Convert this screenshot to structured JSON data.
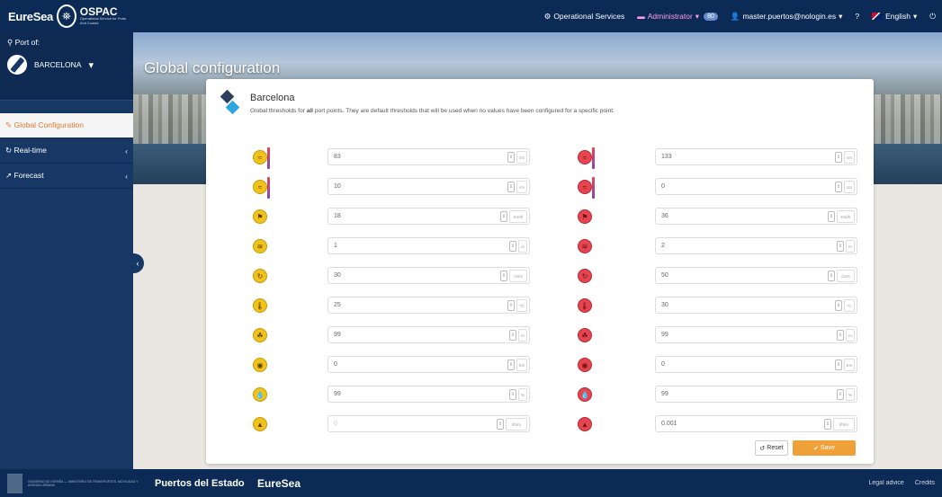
{
  "topbar": {
    "brand": "EureSea",
    "product": "OSPAC",
    "product_sub": "Operational Service for Ports And Coasts",
    "operational_services": "Operational Services",
    "administrator": "Administrator",
    "admin_badge": "80",
    "user": "master.puertos@nologin.es",
    "help": "?",
    "language": "English",
    "power_icon": "power-icon"
  },
  "sidebar": {
    "port_label": "Port of:",
    "port_name": "BARCELONA",
    "items": [
      {
        "label": "Global Configuration",
        "icon": "wrench-icon",
        "active": true
      },
      {
        "label": "Real-time",
        "icon": "refresh-icon"
      },
      {
        "label": "Forecast",
        "icon": "chart-icon"
      }
    ]
  },
  "page": {
    "title": "Global configuration"
  },
  "card": {
    "title": "Barcelona",
    "desc_before": "Global thresholds for ",
    "desc_bold": "all",
    "desc_after": " port points. They are default thresholds that will be used when no values have been configured for a specific point."
  },
  "thresholds": [
    {
      "icon": "wave-height-icon",
      "warn": "83",
      "warn_unit": "cm",
      "alert": "133",
      "alert_unit": "cm"
    },
    {
      "icon": "sea-level-icon",
      "warn": "10",
      "warn_unit": "cm",
      "alert": "0",
      "alert_unit": "cm"
    },
    {
      "icon": "wind-speed-icon",
      "warn": "18",
      "warn_unit": "Km/h",
      "alert": "36",
      "alert_unit": "Km/h"
    },
    {
      "icon": "wave-icon",
      "warn": "1",
      "warn_unit": "m",
      "alert": "2",
      "alert_unit": "m"
    },
    {
      "icon": "current-icon",
      "warn": "30",
      "warn_unit": "cm/s",
      "alert": "50",
      "alert_unit": "cm/s"
    },
    {
      "icon": "temperature-icon",
      "warn": "25",
      "warn_unit": "ºC",
      "alert": "30",
      "alert_unit": "ºC"
    },
    {
      "icon": "water-quality-icon",
      "warn": "99",
      "warn_unit": "m",
      "alert": "99",
      "alert_unit": "m"
    },
    {
      "icon": "visibility-icon",
      "warn": "0",
      "warn_unit": "Km",
      "alert": "0",
      "alert_unit": "Km"
    },
    {
      "icon": "humidity-icon",
      "warn": "99",
      "warn_unit": "%",
      "alert": "99",
      "alert_unit": "%"
    },
    {
      "icon": "precipitation-icon",
      "warn": "0",
      "warn_unit": "l/h/m",
      "alert": "0.001",
      "alert_unit": "l/h/m",
      "warn_disabled": true
    }
  ],
  "buttons": {
    "reset": "Reset",
    "save": "Save"
  },
  "footer": {
    "gov_text": "GOBIERNO DE ESPAÑA — MINISTERIO DE TRANSPORTES, MOVILIDAD Y AGENDA URBANA",
    "puertos": "Puertos del Estado",
    "eurosea": "EureSea",
    "legal": "Legal advice",
    "credits": "Credits"
  },
  "colors": {
    "navbar": "#0b2a55",
    "sidebar": "#173764",
    "warning": "#f0c21c",
    "alert": "#e5454f",
    "save": "#f0a038"
  }
}
